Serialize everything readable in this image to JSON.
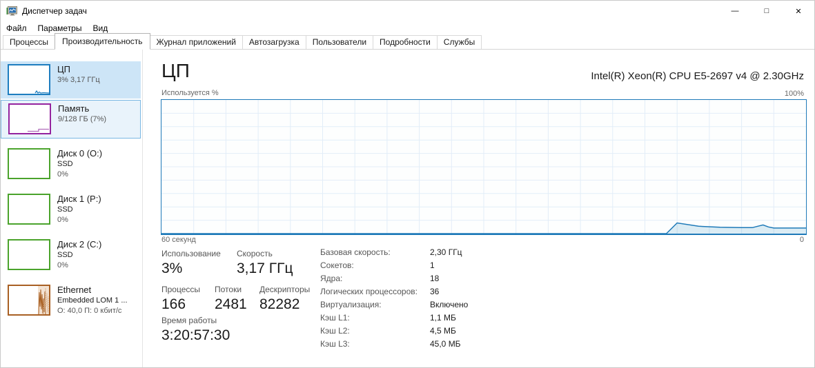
{
  "window": {
    "title": "Диспетчер задач",
    "controls": {
      "minimize": "—",
      "maximize": "□",
      "close": "✕"
    }
  },
  "menu": {
    "items": [
      "Файл",
      "Параметры",
      "Вид"
    ]
  },
  "tabs": {
    "active": "Производительность",
    "items": [
      "Процессы",
      "Производительность",
      "Журнал приложений",
      "Автозагрузка",
      "Пользователи",
      "Подробности",
      "Службы"
    ]
  },
  "sidebar": {
    "items": [
      {
        "id": "cpu",
        "title": "ЦП",
        "line1": "3% 3,17 ГГц"
      },
      {
        "id": "memory",
        "title": "Память",
        "line1": "9/128 ГБ (7%)"
      },
      {
        "id": "disk0",
        "title": "Диск 0 (O:)",
        "line1": "SSD",
        "line2": "0%"
      },
      {
        "id": "disk1",
        "title": "Диск 1 (P:)",
        "line1": "SSD",
        "line2": "0%"
      },
      {
        "id": "disk2",
        "title": "Диск 2 (C:)",
        "line1": "SSD",
        "line2": "0%"
      },
      {
        "id": "ethernet",
        "title": "Ethernet",
        "line1": "Embedded LOM 1 ...",
        "line2": "О: 40,0 П: 0 кбит/с"
      }
    ]
  },
  "main": {
    "title": "ЦП",
    "cpu_name": "Intel(R) Xeon(R) CPU E5-2697 v4 @ 2.30GHz",
    "graph": {
      "top_left_label": "Используется %",
      "top_right_label": "100%",
      "bottom_left_label": "60 секунд",
      "bottom_right_label": "0"
    },
    "stats_left": {
      "utilization_label": "Использование",
      "utilization_value": "3%",
      "speed_label": "Скорость",
      "speed_value": "3,17 ГГц",
      "processes_label": "Процессы",
      "processes_value": "166",
      "threads_label": "Потоки",
      "threads_value": "2481",
      "handles_label": "Дескрипторы",
      "handles_value": "82282",
      "uptime_label": "Время работы",
      "uptime_value": "3:20:57:30"
    },
    "stats_right": {
      "rows": [
        {
          "label": "Базовая скорость:",
          "value": "2,30 ГГц"
        },
        {
          "label": "Сокетов:",
          "value": "1"
        },
        {
          "label": "Ядра:",
          "value": "18"
        },
        {
          "label": "Логических процессоров:",
          "value": "36"
        },
        {
          "label": "Виртуализация:",
          "value": "Включено"
        },
        {
          "label": "Кэш L1:",
          "value": "1,1 МБ"
        },
        {
          "label": "Кэш L2:",
          "value": "4,5 МБ"
        },
        {
          "label": "Кэш L3:",
          "value": "45,0 МБ"
        }
      ]
    }
  },
  "chart_data": {
    "type": "area",
    "title": "ЦП — Используется %",
    "xlabel_left": "60 секунд",
    "xlabel_right": "0",
    "ylabel": "Используется %",
    "ymax_label": "100%",
    "x_range_seconds": [
      60,
      0
    ],
    "ylim": [
      0,
      100
    ],
    "grid": true,
    "series": [
      {
        "name": "Использование ЦП (%)",
        "points_sec_pct": [
          [
            60,
            0
          ],
          [
            30,
            0
          ],
          [
            14,
            0
          ],
          [
            13,
            0
          ],
          [
            12,
            8
          ],
          [
            10,
            5.5
          ],
          [
            8,
            4.8
          ],
          [
            6,
            4.5
          ],
          [
            5,
            4.5
          ],
          [
            4.5,
            5.5
          ],
          [
            4,
            6.5
          ],
          [
            3.5,
            5
          ],
          [
            3,
            4.2
          ],
          [
            2,
            4.2
          ],
          [
            1,
            4.2
          ],
          [
            0,
            4.2
          ]
        ]
      }
    ]
  },
  "colors": {
    "cpu_accent": "#1d79b8",
    "cpu_fill": "rgba(17,125,187,0.14)",
    "grid_line": "#e2edf8",
    "memory_accent": "#94239e",
    "disk_accent": "#4aa32b",
    "network_accent": "#a85f22",
    "selected_bg": "#cde5f7",
    "hover_bg": "#e9f3fb"
  }
}
